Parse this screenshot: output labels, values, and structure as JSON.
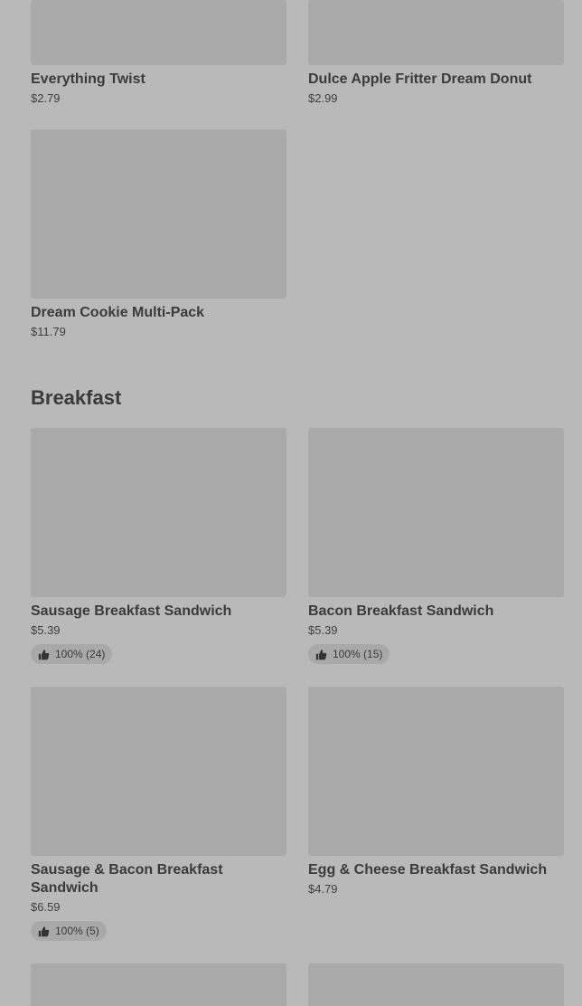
{
  "top_items": [
    {
      "name": "Everything Twist",
      "price": "$2.79"
    },
    {
      "name": "Dulce Apple Fritter Dream Donut",
      "price": "$2.99"
    },
    {
      "name": "Dream Cookie Multi-Pack",
      "price": "$11.79"
    }
  ],
  "breakfast": {
    "title": "Breakfast",
    "items": [
      {
        "name": "Sausage Breakfast Sandwich",
        "price": "$5.39",
        "rating": "100% (24)"
      },
      {
        "name": "Bacon Breakfast Sandwich",
        "price": "$5.39",
        "rating": "100% (15)"
      },
      {
        "name": "Sausage & Bacon Breakfast Sandwich",
        "price": "$6.59",
        "rating": "100% (5)"
      },
      {
        "name": "Egg & Cheese Breakfast Sandwich",
        "price": "$4.79"
      }
    ]
  },
  "icons": {
    "rating": "thumbs-up-icon"
  },
  "colors": {
    "background": "#b9b9b9",
    "image_placeholder": "#aaaaaa",
    "rating_pill": "#a9a9a9"
  }
}
